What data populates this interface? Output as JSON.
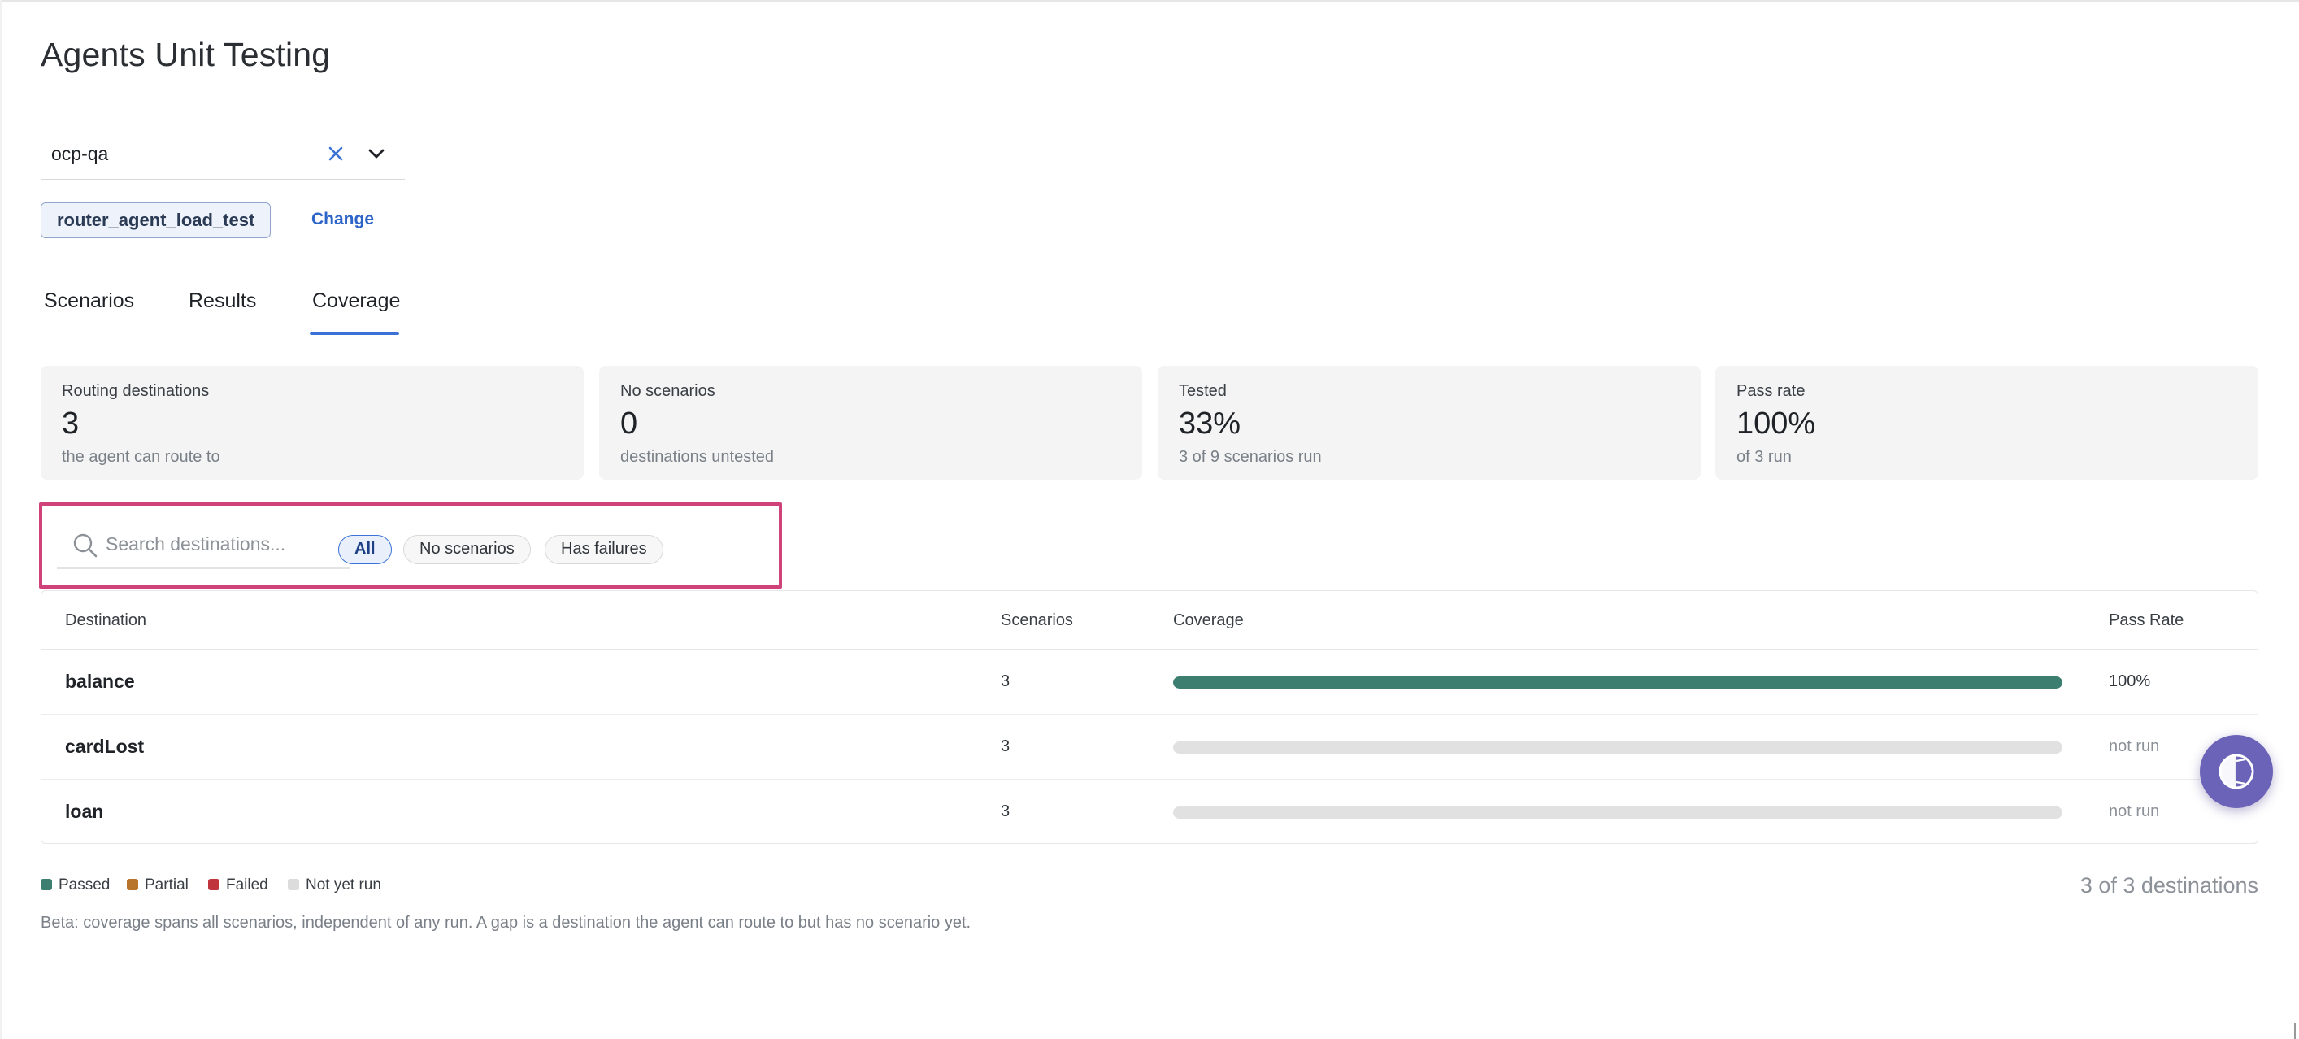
{
  "page": {
    "title": "Agents Unit Testing"
  },
  "agent_selector": {
    "value": "ocp-qa",
    "clear_icon": "close-icon",
    "dropdown_icon": "chevron-down-icon"
  },
  "selected_agent": {
    "label": "router_agent_load_test",
    "change_label": "Change"
  },
  "tabs": [
    {
      "label": "Scenarios",
      "active": false
    },
    {
      "label": "Results",
      "active": false
    },
    {
      "label": "Coverage",
      "active": true
    }
  ],
  "stats": [
    {
      "label": "Routing destinations",
      "value": "3",
      "sub": "the agent can route to"
    },
    {
      "label": "No scenarios",
      "value": "0",
      "sub": "destinations untested"
    },
    {
      "label": "Tested",
      "value": "33%",
      "sub": "3 of 9 scenarios run"
    },
    {
      "label": "Pass rate",
      "value": "100%",
      "sub": "of 3 run"
    }
  ],
  "filters": {
    "search_placeholder": "Search destinations...",
    "search_value": "",
    "pills": [
      {
        "label": "All",
        "active": true
      },
      {
        "label": "No scenarios",
        "active": false
      },
      {
        "label": "Has failures",
        "active": false
      }
    ]
  },
  "table": {
    "headers": {
      "destination": "Destination",
      "scenarios": "Scenarios",
      "coverage": "Coverage",
      "pass_rate": "Pass Rate"
    },
    "rows": [
      {
        "destination": "balance",
        "scenarios": "3",
        "coverage_passed": 1.0,
        "pass_rate": "100%"
      },
      {
        "destination": "cardLost",
        "scenarios": "3",
        "coverage_passed": 0.0,
        "pass_rate": "not run"
      },
      {
        "destination": "loan",
        "scenarios": "3",
        "coverage_passed": 0.0,
        "pass_rate": "not run"
      }
    ]
  },
  "legend": [
    {
      "label": "Passed",
      "color": "#3c7f70"
    },
    {
      "label": "Partial",
      "color": "#b8742a"
    },
    {
      "label": "Failed",
      "color": "#c0353d"
    },
    {
      "label": "Not yet run",
      "color": "#dcdcdc"
    }
  ],
  "summary": {
    "count_text": "3 of 3 destinations"
  },
  "footnote": "Beta: coverage spans all scenarios, independent of any run. A gap is a destination the agent can route to but has no scenario yet.",
  "colors": {
    "accent": "#3a72d6",
    "passed": "#3c7f70",
    "highlight_border": "#d0427a",
    "help_button": "#6b63b8"
  },
  "help_button": {
    "icon": "help-assistant-icon"
  }
}
